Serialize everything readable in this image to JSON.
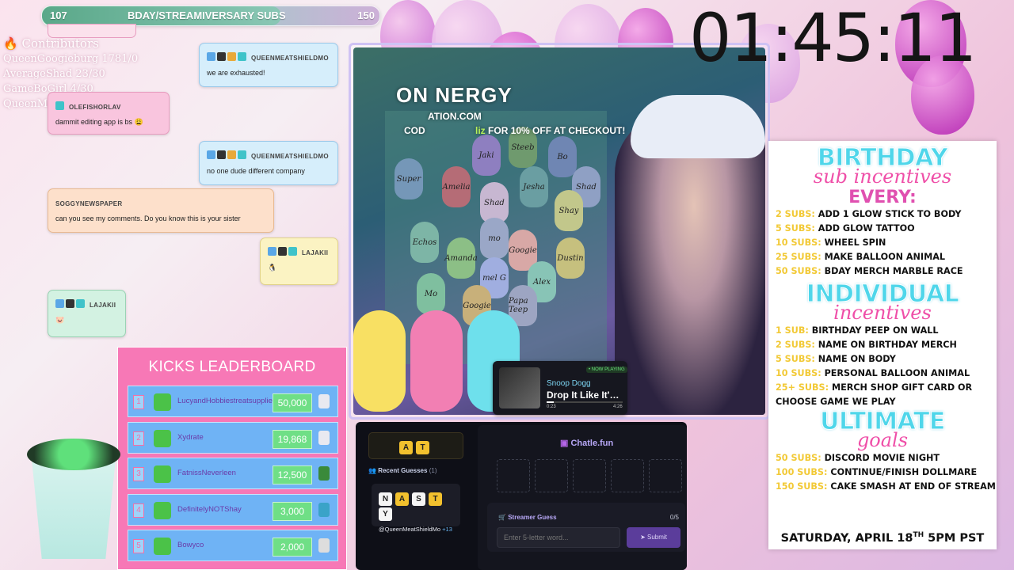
{
  "sub_goal": {
    "title": "BDAY/STREAMIVERSARY SUBS",
    "current": "107",
    "target": "150",
    "progress": 0.71
  },
  "contributors": {
    "title": "Contributors",
    "items": [
      "QueenGoogieburg 1781/0",
      "AverageShad 23/30",
      "GameBoGirl 4/30",
      "QueenMeatShield"
    ]
  },
  "chat": [
    {
      "user": "QUEENMEATSHIELDMO",
      "msg": "we are exhausted!"
    },
    {
      "user": "OLEFISHORLAV",
      "msg": "dammit editing app is bs 😩"
    },
    {
      "user": "QUEENMEATSHIELDMO",
      "msg": "no one dude different company"
    },
    {
      "user": "SOGGYNEWSPAPER",
      "msg": "can you see my comments. Do you know this is your sister"
    },
    {
      "user": "LAJAKII",
      "msg": "🐧"
    },
    {
      "user": "LAJAKII",
      "msg": "🐷"
    }
  ],
  "timer": "01:45:11",
  "stream": {
    "banner_title": "ON   NERGY",
    "banner_url": "ATION.COM",
    "banner_code_prefix": "COD",
    "banner_code": "liz",
    "banner_code_suffix": "FOR 10% OFF AT CHECKOUT!",
    "peeps": [
      "Jaki",
      "Steeb",
      "Bo",
      "Super",
      "Amelia",
      "Jesha",
      "Shad",
      "Shad",
      "mo",
      "Shay",
      "Echos",
      "Amanda",
      "Googie",
      "Dustin",
      "mel G",
      "Alex",
      "Mo",
      "Googie",
      "Papa Teep"
    ]
  },
  "now_playing": {
    "badge": "• NOW PLAYING",
    "artist": "Snoop Dogg",
    "title": "Drop It Like It'…",
    "elapsed": "0:23",
    "duration": "4:26",
    "progress": 0.09
  },
  "incentives": {
    "birthday_title": "BIRTHDAY",
    "birthday_sub": "sub incentives",
    "every": "EVERY:",
    "every_items": [
      {
        "count": "2 SUBS:",
        "text": "ADD 1 GLOW STICK TO BODY"
      },
      {
        "count": "5 SUBS:",
        "text": "ADD GLOW TATTOO"
      },
      {
        "count": "10 SUBS:",
        "text": "WHEEL SPIN"
      },
      {
        "count": "25 SUBS:",
        "text": "MAKE BALLOON ANIMAL"
      },
      {
        "count": "50 SUBS:",
        "text": "BDAY MERCH MARBLE RACE"
      }
    ],
    "individual_title": "INDIVIDUAL",
    "individual_sub": "incentives",
    "individual_items": [
      {
        "count": "1 SUB:",
        "text": "BIRTHDAY PEEP ON WALL"
      },
      {
        "count": "2 SUBS:",
        "text": "NAME ON BIRTHDAY MERCH"
      },
      {
        "count": "5 SUBS:",
        "text": "NAME ON BODY"
      },
      {
        "count": "10 SUBS:",
        "text": "PERSONAL BALLOON ANIMAL"
      },
      {
        "count": "25+ SUBS:",
        "text": "MERCH SHOP GIFT CARD OR"
      },
      {
        "count": "",
        "text": "CHOOSE GAME WE PLAY"
      }
    ],
    "ultimate_title": "ULTIMATE",
    "ultimate_sub": "goals",
    "ultimate_items": [
      {
        "count": "50 SUBS:",
        "text": "DISCORD MOVIE NIGHT"
      },
      {
        "count": "100 SUBS:",
        "text": "CONTINUE/FINISH DOLLMARE"
      },
      {
        "count": "150 SUBS:",
        "text": "CAKE SMASH AT END OF STREAM"
      }
    ],
    "date_main": "SATURDAY, APRIL 18",
    "date_sup": "TH",
    "date_time": " 5PM PST"
  },
  "leaderboard": {
    "title": "KICKS LEADERBOARD",
    "rows": [
      {
        "rank": "1",
        "name": "LucyandHobbiestreatsupplie",
        "amount": "50,000"
      },
      {
        "rank": "2",
        "name": "Xydrate",
        "amount": "19,868"
      },
      {
        "rank": "3",
        "name": "FatnissNeverleen",
        "amount": "12,500"
      },
      {
        "rank": "4",
        "name": "DefinitelyNOTShay",
        "amount": "3,000"
      },
      {
        "rank": "5",
        "name": "Bowyco",
        "amount": "2,000"
      }
    ]
  },
  "game": {
    "current_tiles": [
      "A",
      "T"
    ],
    "recent_title": "Recent Guesses",
    "recent_count": "(1)",
    "guess_tiles": [
      "N",
      "A",
      "S",
      "T",
      "Y"
    ],
    "guess_user": "@QueenMeatShieldMo",
    "guess_points": "+13",
    "brand": "Chatle.fun",
    "streamer_guess_label": "Streamer Guess",
    "streamer_guess_count": "0/5",
    "input_placeholder": "Enter 5-letter word...",
    "submit_label": "Submit"
  },
  "colors": {
    "accent_pink": "#f778b6",
    "accent_blue": "#4fd6ea",
    "gold": "#f2c935",
    "leader_row": "#6fb3f5"
  }
}
